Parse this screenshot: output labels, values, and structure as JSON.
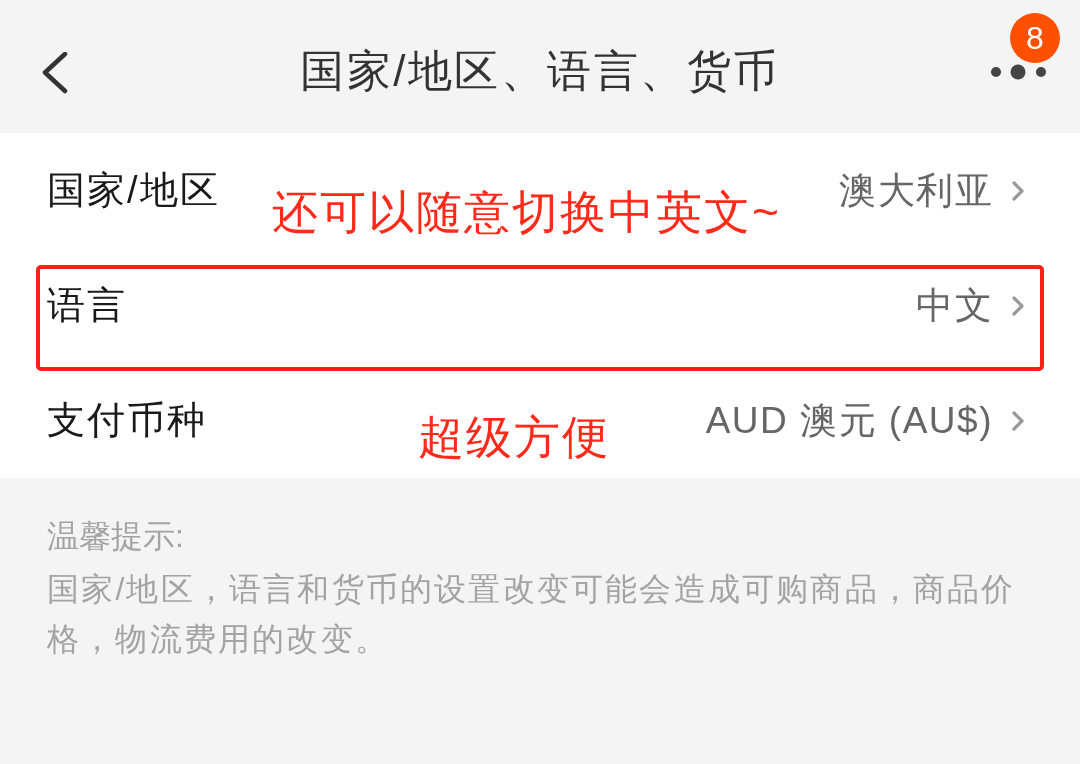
{
  "header": {
    "title": "国家/地区、语言、货币",
    "badge": "8"
  },
  "settings": [
    {
      "label": "国家/地区",
      "value": "澳大利亚",
      "highlighted": false,
      "annotation": "还可以随意切换中英文~"
    },
    {
      "label": "语言",
      "value": "中文",
      "highlighted": true
    },
    {
      "label": "支付币种",
      "value": "AUD 澳元 (AU$)",
      "highlighted": false,
      "annotation": "超级方便"
    }
  ],
  "notice": {
    "title": "温馨提示:",
    "text": "国家/地区，语言和货币的设置改变可能会造成可购商品，商品价格，物流费用的改变。"
  }
}
